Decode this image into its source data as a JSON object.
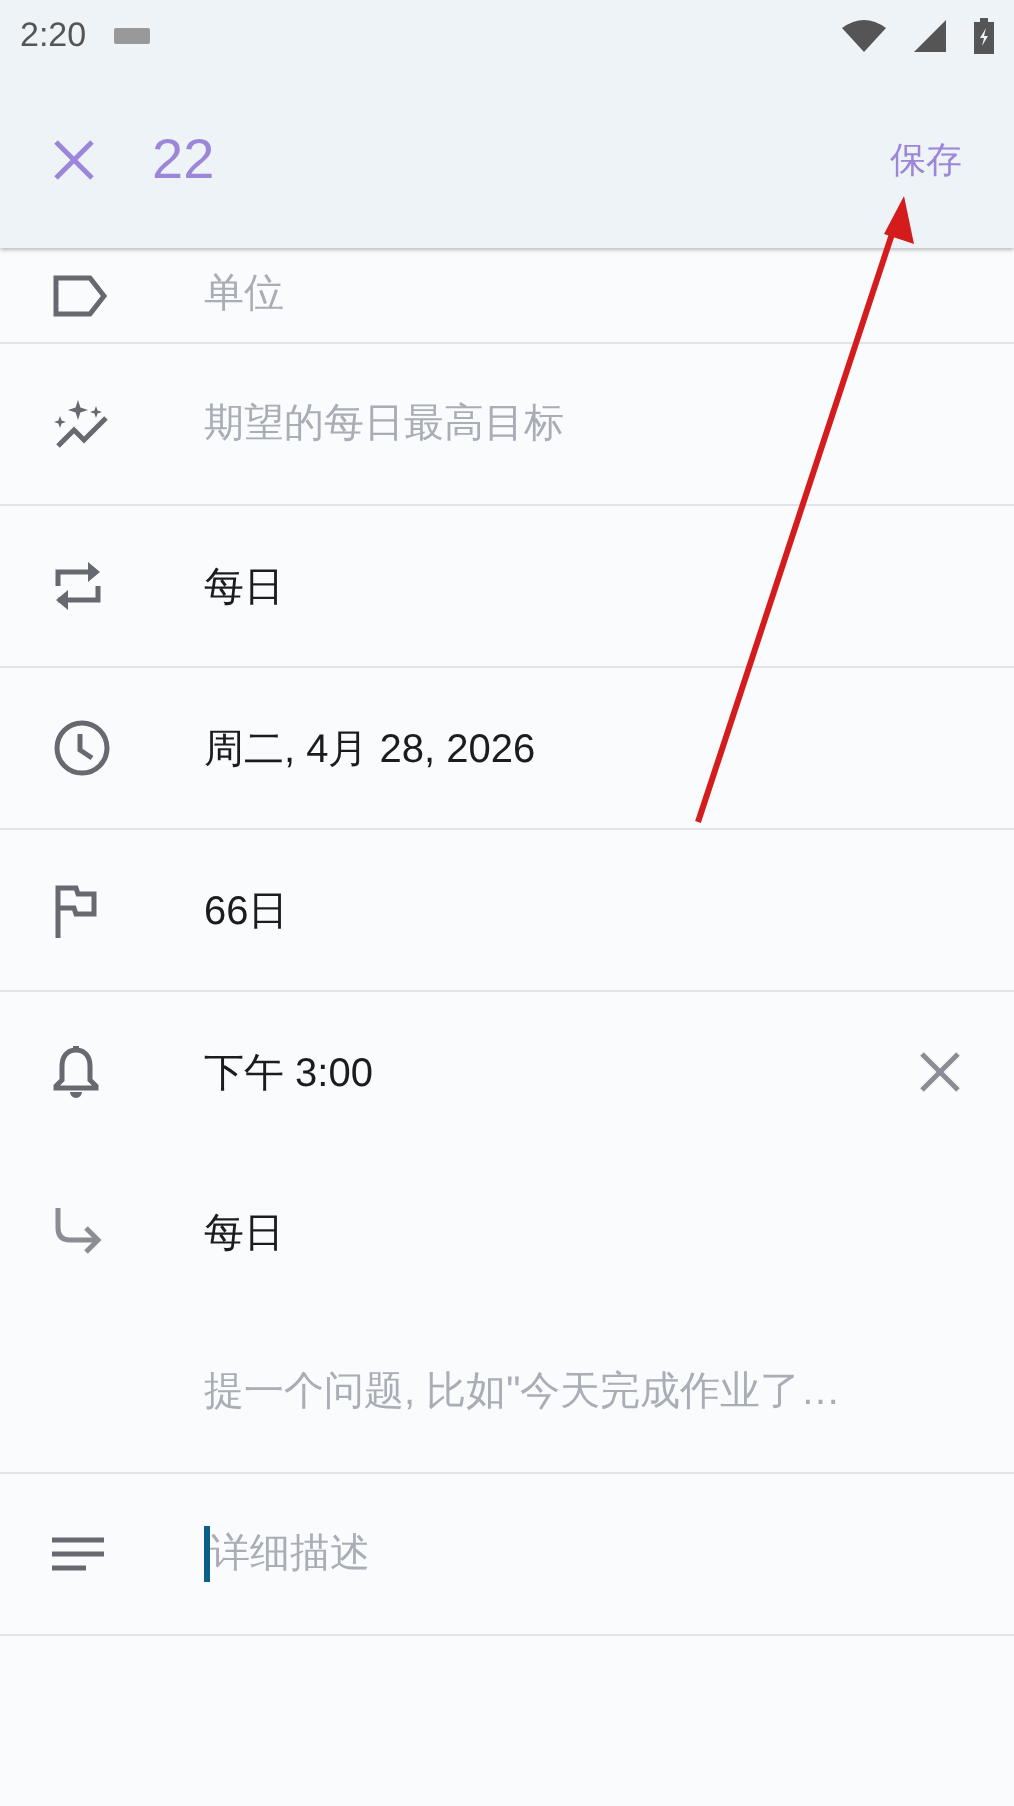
{
  "status_bar": {
    "time": "2:20"
  },
  "app_bar": {
    "title": "22",
    "action": "保存"
  },
  "sections": [
    {
      "fields": [
        {
          "kind": "unit",
          "placeholder": "单位"
        }
      ]
    },
    {
      "fields": [
        {
          "kind": "goal",
          "placeholder": "期望的每日最高目标"
        }
      ]
    },
    {
      "fields": [
        {
          "kind": "repeat",
          "value": "每日"
        }
      ]
    },
    {
      "fields": [
        {
          "kind": "date",
          "value": "周二, 4月 28, 2026"
        }
      ]
    },
    {
      "fields": [
        {
          "kind": "duration",
          "value": "66日"
        }
      ]
    },
    {
      "fields": [
        {
          "kind": "reminder",
          "value": "下午 3:00",
          "clearable": true
        },
        {
          "kind": "reminder_repeat",
          "value": "每日"
        },
        {
          "kind": "question",
          "placeholder": "提一个问题, 比如\"今天完成作业了…"
        }
      ]
    },
    {
      "fields": [
        {
          "kind": "description",
          "placeholder": "详细描述",
          "focused": true
        }
      ]
    }
  ]
}
